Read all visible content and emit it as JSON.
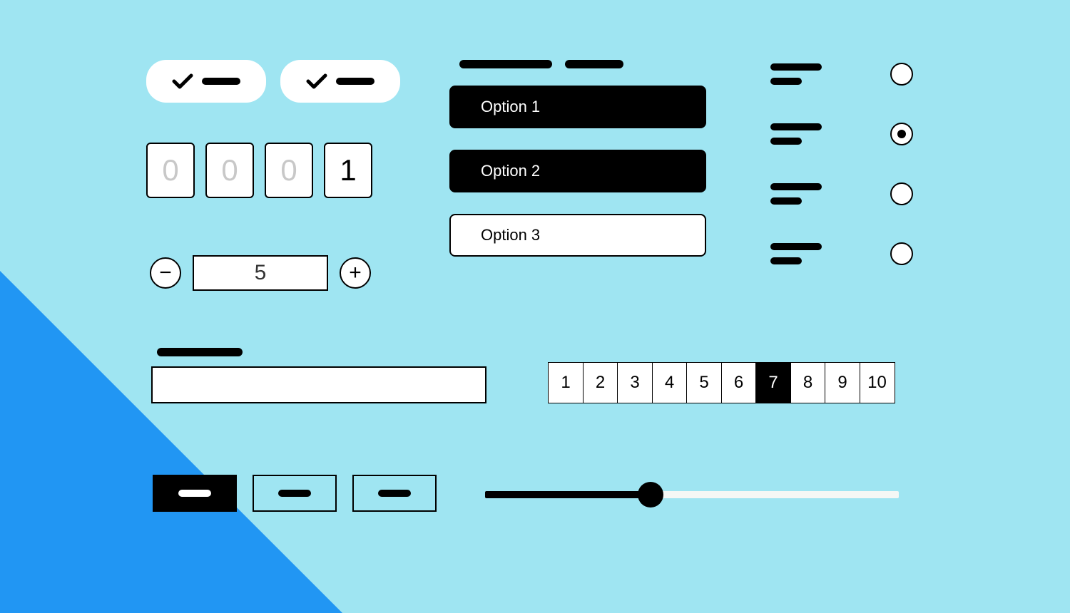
{
  "chips": [
    {
      "checked": true
    },
    {
      "checked": true
    }
  ],
  "pin": {
    "digits": [
      "0",
      "0",
      "0",
      "1"
    ],
    "filled_index": 3
  },
  "stepper": {
    "value": "5"
  },
  "options": {
    "items": [
      {
        "label": "Option 1",
        "selected": true
      },
      {
        "label": "Option 2",
        "selected": true
      },
      {
        "label": "Option 3",
        "selected": false
      }
    ]
  },
  "radios": {
    "selected_index": 1,
    "count": 4
  },
  "pagination": {
    "pages": [
      "1",
      "2",
      "3",
      "4",
      "5",
      "6",
      "7",
      "8",
      "9",
      "10"
    ],
    "active": "7"
  },
  "buttons": {
    "active_index": 0,
    "count": 3
  },
  "slider": {
    "percent": 40
  }
}
